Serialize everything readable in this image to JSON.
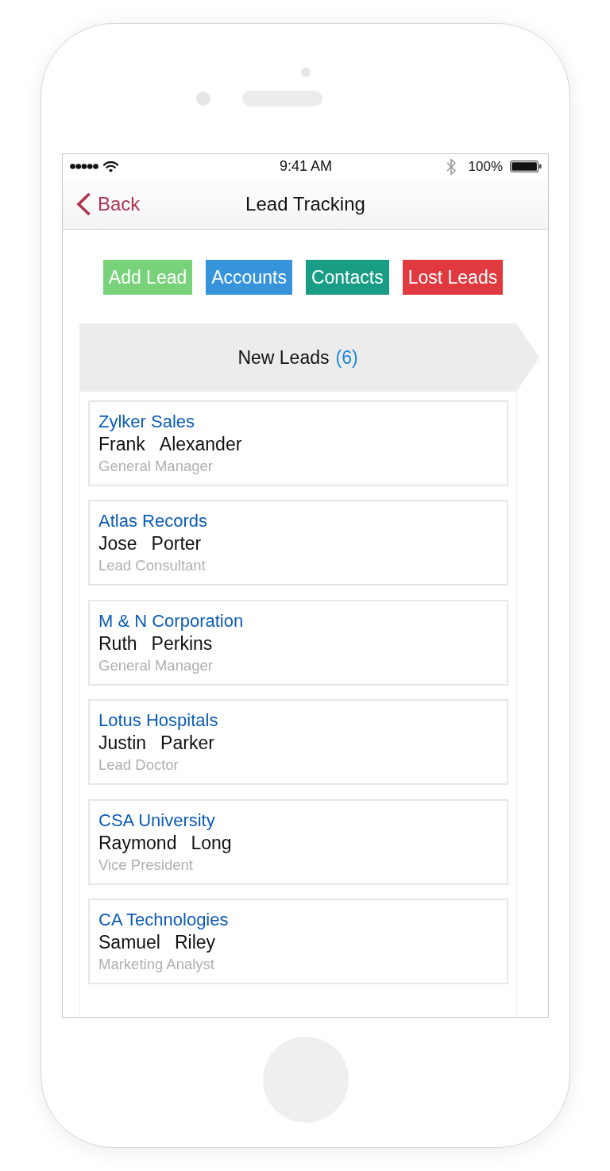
{
  "status_bar": {
    "time": "9:41 AM",
    "battery": "100%"
  },
  "nav_bar": {
    "back_label": "Back",
    "title": "Lead Tracking"
  },
  "actions": [
    {
      "label": "Add Lead",
      "color": "#78d27a"
    },
    {
      "label": "Accounts",
      "color": "#3794da"
    },
    {
      "label": "Contacts",
      "color": "#199e85"
    },
    {
      "label": "Lost Leads",
      "color": "#e0393f"
    }
  ],
  "stage": {
    "title": "New Leads",
    "count": "(6)"
  },
  "leads": [
    {
      "company": "Zylker Sales",
      "first_name": "Frank",
      "last_name": "Alexander",
      "title": "General Manager"
    },
    {
      "company": "Atlas Records",
      "first_name": "Jose",
      "last_name": "Porter",
      "title": "Lead Consultant"
    },
    {
      "company": "M & N Corporation",
      "first_name": "Ruth",
      "last_name": "Perkins",
      "title": "General Manager"
    },
    {
      "company": "Lotus Hospitals",
      "first_name": "Justin",
      "last_name": "Parker",
      "title": "Lead Doctor"
    },
    {
      "company": "CSA University",
      "first_name": "Raymond",
      "last_name": "Long",
      "title": "Vice President"
    },
    {
      "company": "CA Technologies",
      "first_name": "Samuel",
      "last_name": "Riley",
      "title": "Marketing Analyst"
    }
  ]
}
